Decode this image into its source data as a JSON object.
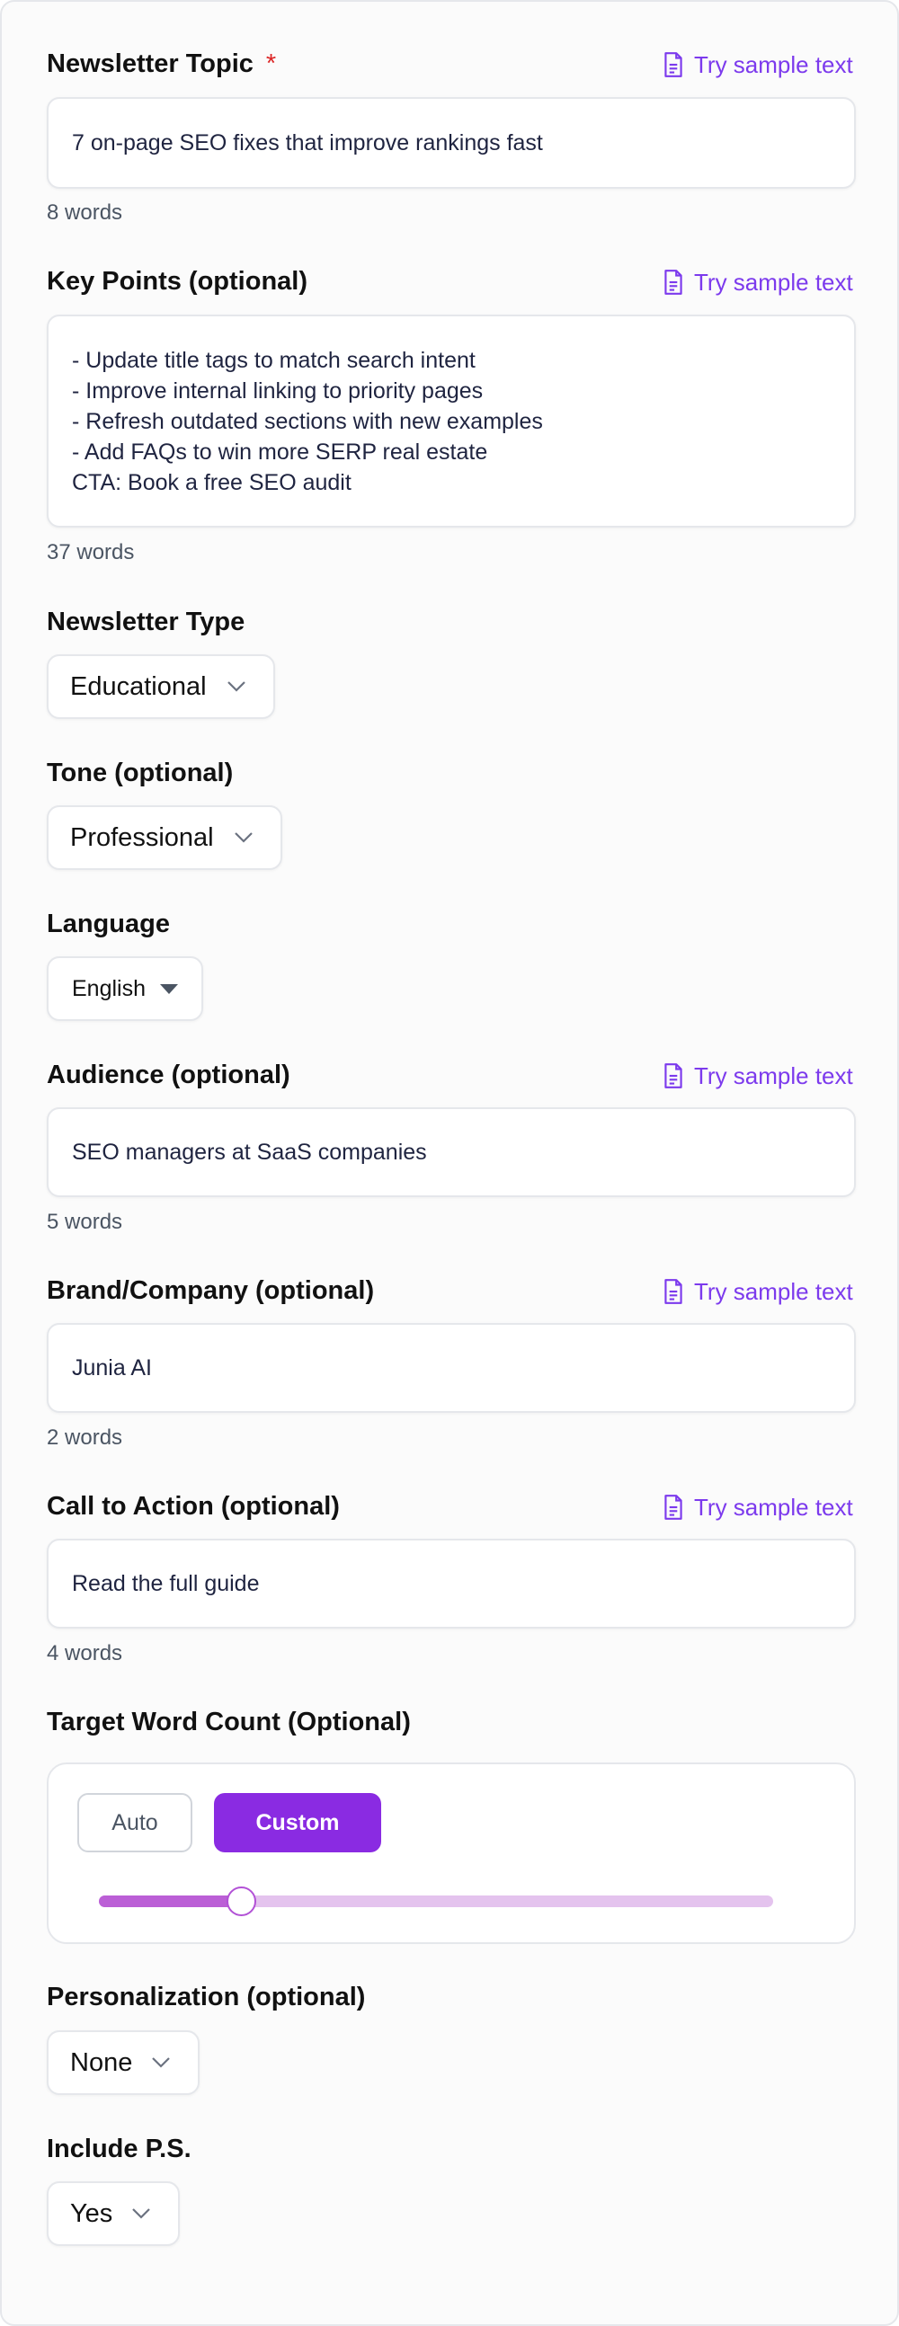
{
  "sample_link_label": "Try sample text",
  "colors": {
    "accent": "#7c3aed",
    "required": "#dc2626",
    "slider_fill": "#bb5fd6",
    "slider_track": "#e4c3ee",
    "custom_button": "#8a2be2"
  },
  "topic": {
    "label": "Newsletter Topic",
    "required_mark": "*",
    "value": "7 on-page SEO fixes that improve rankings fast",
    "count": "8 words"
  },
  "key_points": {
    "label": "Key Points (optional)",
    "value": "- Update title tags to match search intent\n- Improve internal linking to priority pages\n- Refresh outdated sections with new examples\n- Add FAQs to win more SERP real estate\nCTA: Book a free SEO audit",
    "count": "37 words"
  },
  "newsletter_type": {
    "label": "Newsletter Type",
    "selected": "Educational"
  },
  "tone": {
    "label": "Tone (optional)",
    "selected": "Professional"
  },
  "language": {
    "label": "Language",
    "selected": "English"
  },
  "audience": {
    "label": "Audience (optional)",
    "value": "SEO managers at SaaS companies",
    "count": "5 words"
  },
  "brand": {
    "label": "Brand/Company (optional)",
    "value": "Junia AI",
    "count": "2 words"
  },
  "cta": {
    "label": "Call to Action (optional)",
    "value": "Read the full guide",
    "count": "4 words"
  },
  "word_count": {
    "label": "Target Word Count (Optional)",
    "auto_label": "Auto",
    "custom_label": "Custom",
    "active_mode": "Custom",
    "slider_fraction": 0.21
  },
  "personalization": {
    "label": "Personalization (optional)",
    "selected": "None"
  },
  "include_ps": {
    "label": "Include P.S.",
    "selected": "Yes"
  }
}
